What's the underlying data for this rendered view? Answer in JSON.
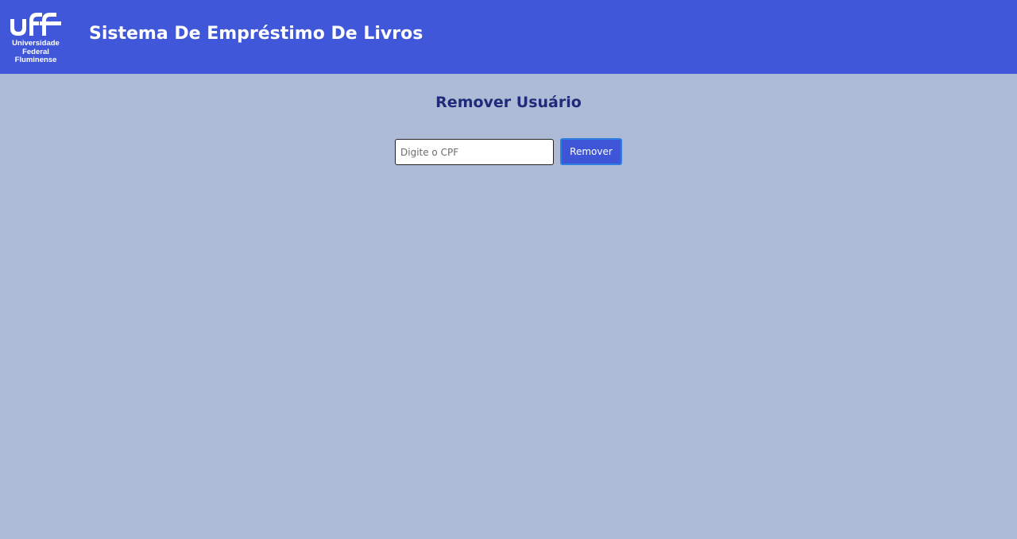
{
  "header": {
    "logo": {
      "mark": "uff",
      "line1": "Universidade",
      "line2": "Federal",
      "line3": "Fluminense"
    },
    "title": "Sistema De Empréstimo De Livros"
  },
  "main": {
    "title": "Remover Usuário",
    "cpf_input": {
      "value": "",
      "placeholder": "Digite o CPF"
    },
    "remove_button_label": "Remover"
  },
  "colors": {
    "header_bg": "#4157d9",
    "page_bg": "#adbbd6",
    "title_text": "#1f2b7a",
    "button_bg": "#3f55d8"
  }
}
